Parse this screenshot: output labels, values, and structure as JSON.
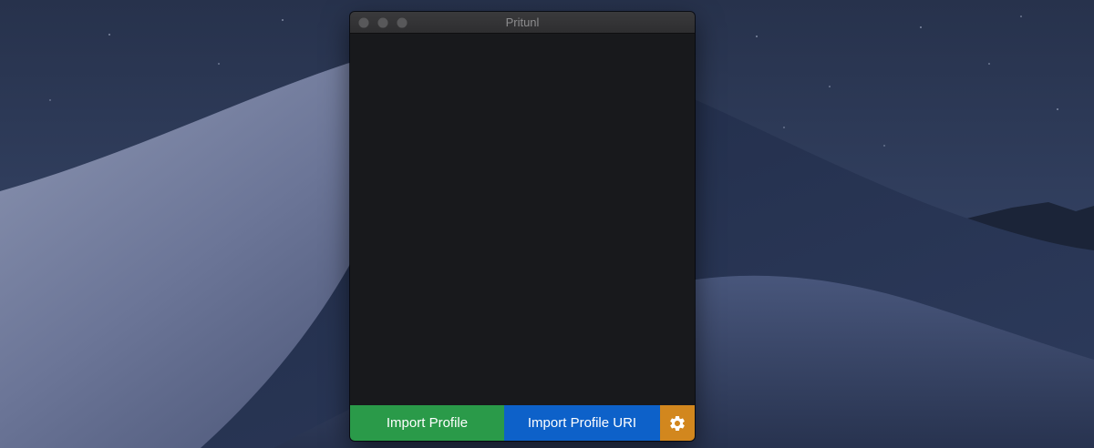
{
  "window": {
    "title": "Pritunl"
  },
  "footer": {
    "import_profile_label": "Import Profile",
    "import_profile_uri_label": "Import Profile URI",
    "settings_icon": "gear-icon"
  },
  "colors": {
    "import_profile": "#2a9a49",
    "import_profile_uri": "#0d61c9",
    "settings": "#d2871e",
    "content_background": "#18191c"
  }
}
